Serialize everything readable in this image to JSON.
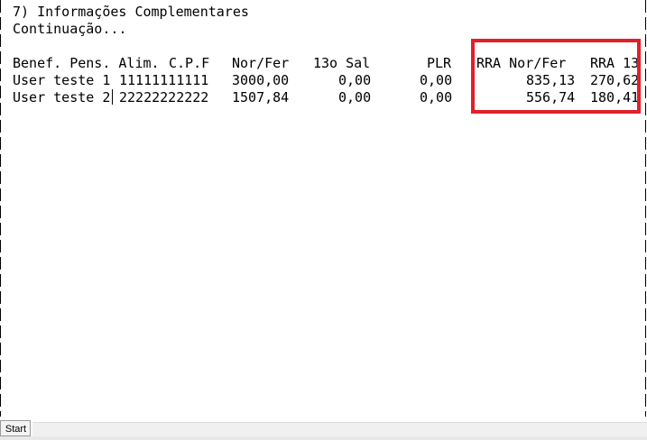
{
  "terminal": {
    "section_title": "7) Informações Complementares",
    "continuation": "Continuação...",
    "headers": {
      "benef": "Benef. Pens. Alim.",
      "cpf": "C.P.F",
      "nor_fer": "Nor/Fer",
      "decimo_terceiro": "13o Sal",
      "plr": "PLR",
      "rra_nor_fer": "RRA Nor/Fer",
      "rra_13": "RRA 13"
    },
    "rows": [
      {
        "name": "User teste 1",
        "cpf": "11111111111",
        "nor_fer": "3000,00",
        "decimo_terceiro": "0,00",
        "plr": "0,00",
        "rra_nor_fer": "835,13",
        "rra_13": "270,62"
      },
      {
        "name": "User teste 2",
        "cpf": "22222222222",
        "nor_fer": "1507,84",
        "decimo_terceiro": "0,00",
        "plr": "0,00",
        "rra_nor_fer": "556,74",
        "rra_13": "180,41"
      }
    ]
  },
  "taskbar": {
    "start_label": "Start"
  },
  "colors": {
    "highlight_border": "#e0202a",
    "text": "#000000",
    "background": "#ffffff"
  }
}
